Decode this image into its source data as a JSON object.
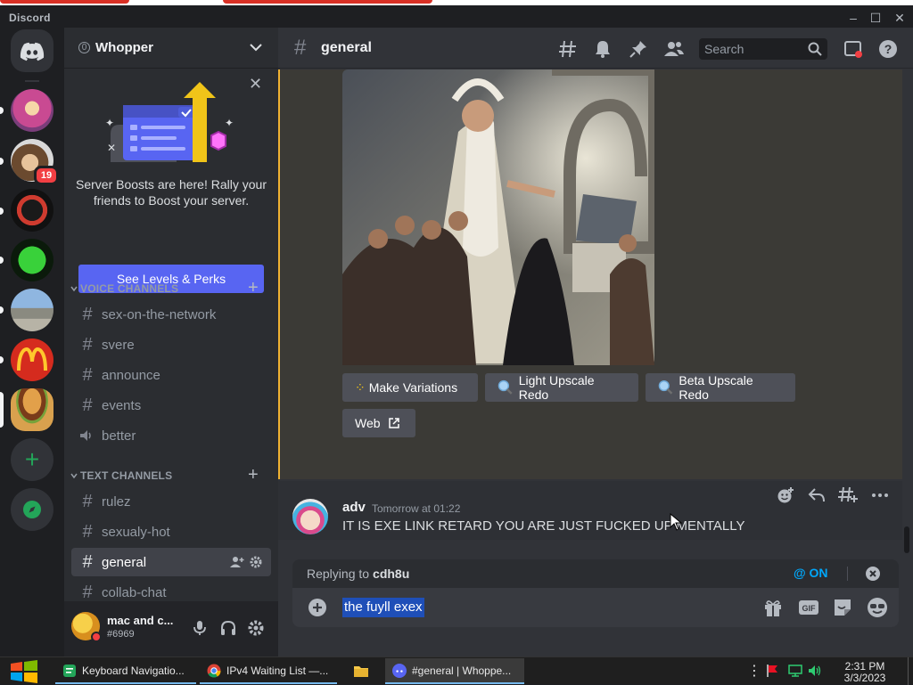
{
  "app": {
    "title": "Discord"
  },
  "window": {
    "minimize": "–",
    "maximize": "☐",
    "close": "✕"
  },
  "servers": {
    "mention_badge": "19"
  },
  "guild": {
    "name": "Whopper",
    "icon_badge": "0"
  },
  "boost": {
    "text": "Server Boosts are here! Rally your friends to Boost your server.",
    "button": "See Levels & Perks"
  },
  "sidebar": {
    "voice_category": "VOICE CHANNELS",
    "voice_channels": [
      "sex-on-the-network",
      "svere",
      "announce",
      "events",
      "better"
    ],
    "text_category": "TEXT CHANNELS",
    "text_channels": [
      "rulez",
      "sexualy-hot",
      "general",
      "collab-chat"
    ]
  },
  "user": {
    "name": "mac and c...",
    "tag": "#6969"
  },
  "channel": {
    "name": "general"
  },
  "search": {
    "placeholder": "Search"
  },
  "bot_message": {
    "buttons": {
      "make_variations": "Make Variations",
      "light_upscale": "Light Upscale Redo",
      "beta_upscale": "Beta Upscale Redo",
      "web": "Web"
    },
    "emoji_buttons": [
      "😖",
      "😒",
      "😀",
      "😍"
    ]
  },
  "message": {
    "author": "adv",
    "timestamp": "Tomorrow at 01:22",
    "text": "IT IS EXE LINK RETARD YOU ARE JUST FUCKED UP MENTALLY"
  },
  "reply": {
    "label": "Replying to",
    "target": "cdh8u",
    "mention_toggle": "@ ON"
  },
  "composer": {
    "value": "the fuyll exex"
  },
  "taskbar": {
    "items": [
      "Keyboard Navigatio...",
      "IPv4 Waiting List —...",
      "#general | Whoppe..."
    ],
    "time": "2:31 PM",
    "date": "3/3/2023"
  },
  "colors": {
    "blurple": "#5865f2",
    "green": "#23a559",
    "red": "#f23f43",
    "mention_highlight": "#f0b232",
    "mention_blue": "#00a8fc"
  }
}
